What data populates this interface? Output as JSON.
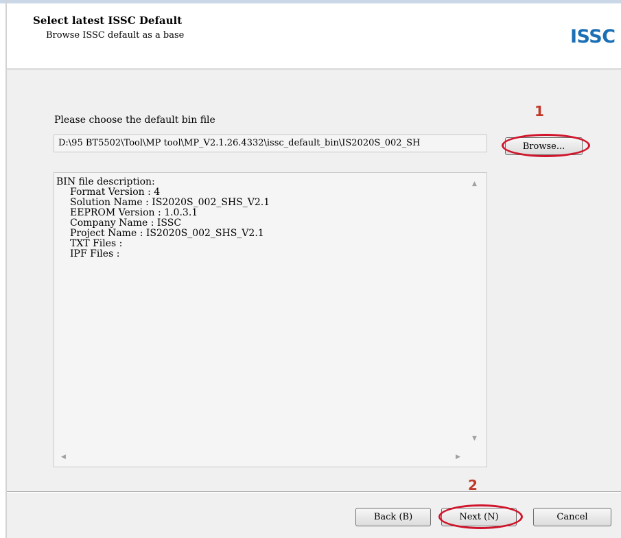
{
  "header": {
    "title": "Select latest ISSC Default",
    "subtitle": "Browse ISSC default as a base",
    "logo_text": "ISSC",
    "logo_color": "#1b6fb5"
  },
  "file_picker": {
    "label": "Please choose the default bin file",
    "path_value": "D:\\95 BT5502\\Tool\\MP tool\\MP_V2.1.26.4332\\issc_default_bin\\IS2020S_002_SH",
    "browse_label": "Browse..."
  },
  "description": {
    "heading": "BIN file description:",
    "lines": [
      "Format Version : 4",
      "Solution Name : IS2020S_002_SHS_V2.1",
      "EEPROM Version : 1.0.3.1",
      "Company Name : ISSC",
      "Project Name : IS2020S_002_SHS_V2.1",
      "TXT Files :",
      "IPF Files :"
    ]
  },
  "buttons": {
    "back": "Back (B)",
    "next": "Next (N)",
    "cancel": "Cancel"
  },
  "annotations": {
    "step1": "1",
    "step2": "2",
    "highlight_color": "#d0142b"
  }
}
